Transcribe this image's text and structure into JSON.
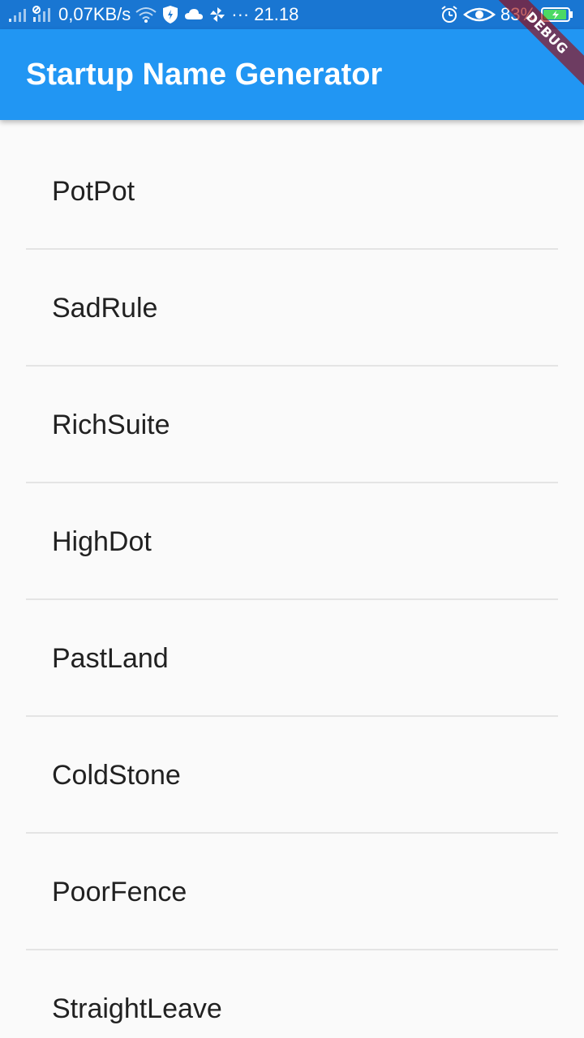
{
  "status_bar": {
    "net_speed": "0,07KB/s",
    "more": "···",
    "time": "21.18",
    "battery_percent": "83%",
    "icons": [
      "signal-icon",
      "signal-icon",
      "wifi-icon",
      "shield-icon",
      "cloud-icon",
      "pinwheel-icon",
      "alarm-icon",
      "eye-icon",
      "battery-icon"
    ]
  },
  "debug_banner": {
    "label": "DEBUG"
  },
  "app_bar": {
    "title": "Startup Name Generator"
  },
  "list": {
    "items": [
      "PotPot",
      "SadRule",
      "RichSuite",
      "HighDot",
      "PastLand",
      "ColdStone",
      "PoorFence",
      "StraightLeave"
    ]
  },
  "colors": {
    "status_bar": "#1976d2",
    "app_bar": "#2196f3",
    "background": "#fafafa",
    "divider": "#e4e4e4",
    "text": "#212121",
    "battery": "#4cd964"
  }
}
